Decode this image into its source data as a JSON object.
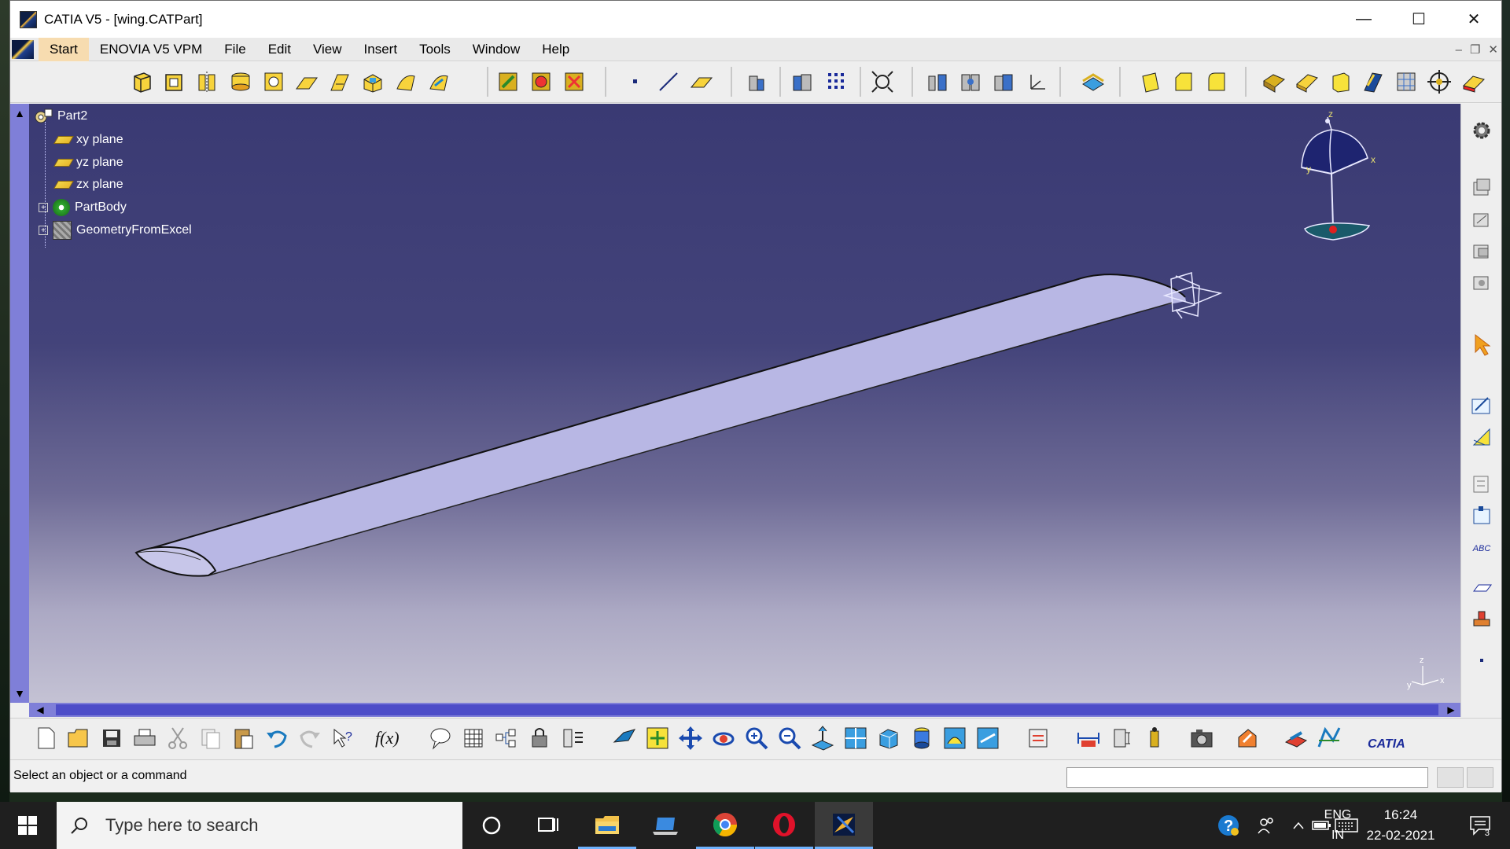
{
  "window": {
    "title": "CATIA V5 - [wing.CATPart]",
    "controls": {
      "minimize": "—",
      "maximize": "☐",
      "close": "✕"
    }
  },
  "menubar": {
    "items": [
      "Start",
      "ENOVIA V5 VPM",
      "File",
      "Edit",
      "View",
      "Insert",
      "Tools",
      "Window",
      "Help"
    ]
  },
  "tree": {
    "root": "Part2",
    "items": [
      {
        "label": "xy plane",
        "icon": "plane-icon"
      },
      {
        "label": "yz plane",
        "icon": "plane-icon"
      },
      {
        "label": "zx plane",
        "icon": "plane-icon"
      },
      {
        "label": "PartBody",
        "icon": "partbody-icon",
        "expandable": true
      },
      {
        "label": "GeometryFromExcel",
        "icon": "geometry-set-icon",
        "expandable": true
      }
    ]
  },
  "compass": {
    "axis_x": "x",
    "axis_y": "y",
    "axis_z": "z"
  },
  "small_axis": {
    "axis_x": "x",
    "axis_y": "y",
    "axis_z": "z"
  },
  "right_toolbar": {
    "abc_label": "ABC"
  },
  "status": {
    "message": "Select an object or a command",
    "command_input": ""
  },
  "bottom_toolbar": {
    "function_label": "f(x)",
    "catia_logo": "CATIA"
  },
  "taskbar": {
    "search_placeholder": "Type here to search",
    "lang_line1": "ENG",
    "lang_line2": "IN",
    "time": "16:24",
    "date": "22-02-2021",
    "notification_count": "3"
  },
  "colors": {
    "viewport_top": "#3a3a73",
    "viewport_bottom": "#c4c2d4",
    "scrollbar": "#7f7fd8",
    "wing_fill": "#b9b9e6",
    "start_highlight": "#f7dcb0"
  }
}
